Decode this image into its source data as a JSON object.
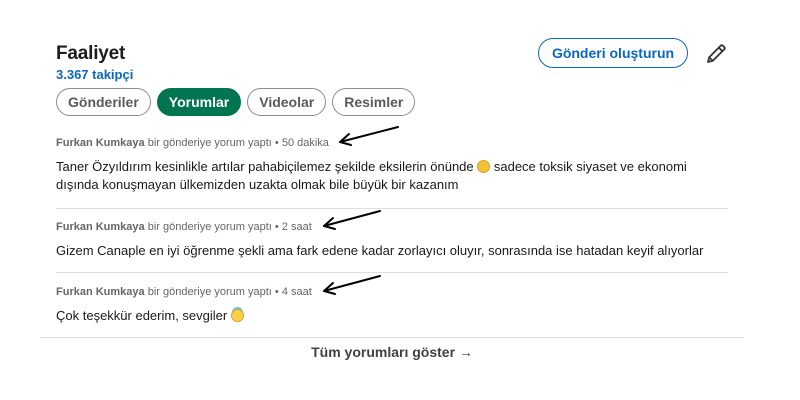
{
  "header": {
    "title": "Faaliyet",
    "followers": "3.367 takipçi",
    "create_post_label": "Gönderi oluşturun",
    "edit_icon": "pencil-icon"
  },
  "tabs": [
    {
      "label": "Gönderiler",
      "active": false
    },
    {
      "label": "Yorumlar",
      "active": true
    },
    {
      "label": "Videolar",
      "active": false
    },
    {
      "label": "Resimler",
      "active": false
    }
  ],
  "posts": [
    {
      "author": "Furkan Kumkaya",
      "action": "bir gönderiye yorum yaptı",
      "separator": "•",
      "time": "50 dakika",
      "text_before_emoji": "Taner Özyıldırım kesinlikle artılar pahabiçilemez şekilde eksilerin önünde ",
      "emoji": "money-face-emoji",
      "text_after_emoji": " sadece toksik siyaset ve ekonomi dışında konuşmayan ülkemizden uzakta olmak bile büyük bir kazanım"
    },
    {
      "author": "Furkan Kumkaya",
      "action": "bir gönderiye yorum yaptı",
      "separator": "•",
      "time": "2 saat",
      "text": "Gizem Canaple en iyi öğrenme şekli ama fark edene kadar zorlayıcı oluyır, sonrasında ise hatadan keyif alıyorlar"
    },
    {
      "author": "Furkan Kumkaya",
      "action": "bir gönderiye yorum yaptı",
      "separator": "•",
      "time": "4 saat",
      "text": "Çok teşekkür ederim, sevgiler ",
      "emoji": "halo-face-emoji"
    }
  ],
  "footer": {
    "show_all_label": "Tüm yorumları göster →"
  },
  "colors": {
    "link_blue": "#0a66c2",
    "active_tab_green": "#01754f",
    "meta_gray": "#666666"
  },
  "annotations": [
    "arrow-icon",
    "arrow-icon",
    "arrow-icon"
  ]
}
